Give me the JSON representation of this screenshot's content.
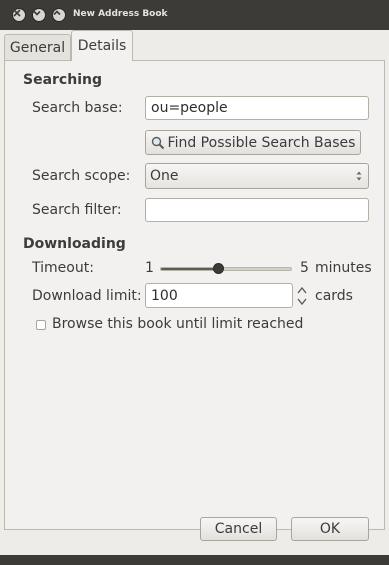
{
  "window": {
    "title": "New Address Book",
    "close_label": "×"
  },
  "tabs": [
    {
      "label": "General",
      "active": false
    },
    {
      "label": "Details",
      "active": true
    }
  ],
  "searching": {
    "heading": "Searching",
    "search_base_label": "Search base:",
    "search_base_value": "ou=people",
    "find_button_label": "Find Possible Search Bases",
    "search_scope_label": "Search scope:",
    "search_scope_value": "One",
    "search_filter_label": "Search filter:",
    "search_filter_value": ""
  },
  "downloading": {
    "heading": "Downloading",
    "timeout_label": "Timeout:",
    "timeout_min": "1",
    "timeout_max": "5",
    "timeout_unit": "minutes",
    "timeout_level": 0.44,
    "download_limit_label": "Download limit:",
    "download_limit_value": "100",
    "download_limit_unit": "cards",
    "browse_checkbox_label": "Browse this book until limit reached",
    "browse_checked": false
  },
  "buttons": {
    "cancel": "Cancel",
    "ok": "OK"
  },
  "colors": {
    "titlebar": "#3c3b37",
    "dialog_bg": "#edece9",
    "panel_bg": "#f2f1f0"
  },
  "icons": {
    "close": "close-icon",
    "minimize": "minimize-icon",
    "maximize": "maximize-icon",
    "find": "magnifier-icon",
    "combo": "updown-arrows-icon",
    "spin": "spin-arrows-icon"
  }
}
